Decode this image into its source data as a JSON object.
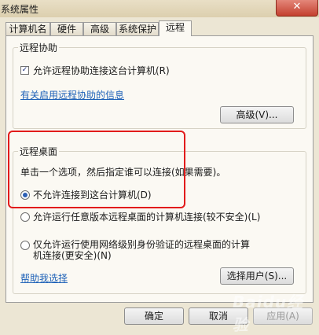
{
  "window": {
    "title": "系统属性",
    "close_symbol": "✕"
  },
  "tabs": [
    {
      "label": "计算机名"
    },
    {
      "label": "硬件"
    },
    {
      "label": "高级"
    },
    {
      "label": "系统保护"
    },
    {
      "label": "远程",
      "active": true
    }
  ],
  "remote_assistance": {
    "title": "远程协助",
    "allow_checkbox_label": "允许远程协助连接这台计算机(R)",
    "allow_checked": true,
    "info_link": "有关启用远程协助的信息",
    "advanced_button": "高级(V)..."
  },
  "remote_desktop": {
    "title": "远程桌面",
    "instruction": "单击一个选项，然后指定谁可以连接(如果需要)。",
    "options": [
      {
        "label": "不允许连接到这台计算机(D)",
        "checked": true
      },
      {
        "label": "允许运行任意版本远程桌面的计算机连接(较不安全)(L)",
        "checked": false
      },
      {
        "label_line1": "仅允许运行使用网络级别身份验证的远程桌面的计算",
        "label_line2": "机连接(更安全)(N)",
        "checked": false
      }
    ],
    "help_link": "帮助我选择",
    "select_users_button": "选择用户(S)..."
  },
  "footer": {
    "ok_button": "确定",
    "cancel_button": "取消",
    "apply_button": "应用(A)"
  },
  "watermark": "Baidu经验"
}
